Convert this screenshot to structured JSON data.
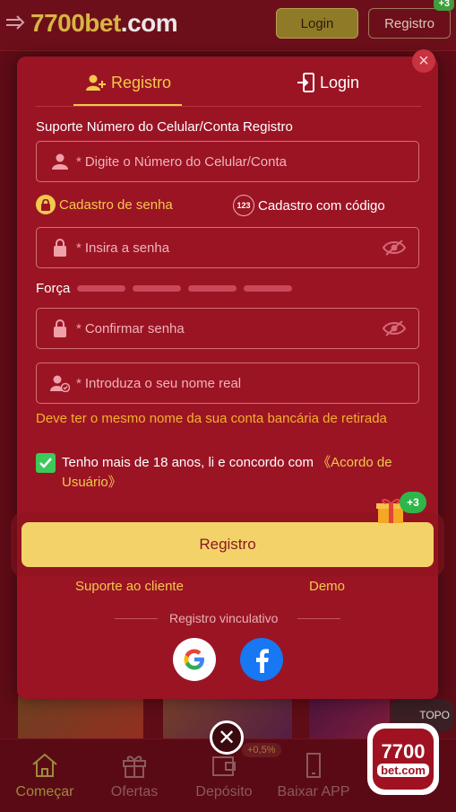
{
  "header": {
    "logo": "7700bet.com",
    "logo_main": "7700bet",
    "logo_suffix": ".com",
    "login_label": "Login",
    "register_label": "Registro",
    "register_badge": "+3"
  },
  "modal": {
    "tabs": [
      {
        "label": "Registro",
        "active": true
      },
      {
        "label": "Login",
        "active": false
      }
    ],
    "section_label": "Suporte Número do Celular/Conta Registro",
    "phone_field": {
      "required": "*",
      "placeholder": "Digite o Número do Celular/Conta"
    },
    "options": [
      {
        "label": "Cadastro de senha",
        "active": true
      },
      {
        "label": "Cadastro com código",
        "icon_text": "123",
        "active": false
      }
    ],
    "password_field": {
      "required": "*",
      "placeholder": "Insira a senha"
    },
    "strength": {
      "label": "Força",
      "segments": 4
    },
    "confirm_field": {
      "required": "*",
      "placeholder": "Confirmar senha"
    },
    "name_field": {
      "required": "*",
      "placeholder": "Introduza o seu nome real"
    },
    "name_warning": "Deve ter o mesmo nome da sua conta bancária de retirada",
    "agreement": {
      "checked": true,
      "text": "Tenho mais de 18 anos, li e concordo com",
      "link": "《Acordo de Usuário》"
    },
    "gift_badge": "+3",
    "submit_label": "Registro",
    "support_link": "Suporte ao cliente",
    "demo_link": "Demo",
    "binding_label": "Registro vinculativo",
    "social": [
      "google-icon",
      "facebook-icon"
    ]
  },
  "background": {
    "rate_badge": "+0,5%",
    "topo_label": "TOPO",
    "corner_logo_top": "7700",
    "corner_logo_bottom": "bet.com"
  },
  "bottom_nav": [
    {
      "label": "Começar",
      "icon": "home-icon",
      "active": true
    },
    {
      "label": "Ofertas",
      "icon": "gift-icon",
      "active": false
    },
    {
      "label": "Depósito",
      "icon": "wallet-icon",
      "active": false
    },
    {
      "label": "Baixar APP",
      "icon": "phone-icon",
      "active": false
    }
  ],
  "colors": {
    "modal_bg": "#9b1424",
    "accent_gold": "#f2c94c",
    "button_bg": "#f4d26a",
    "warning": "#f2b229",
    "check_green": "#3dc85a",
    "facebook_blue": "#1877f2"
  }
}
